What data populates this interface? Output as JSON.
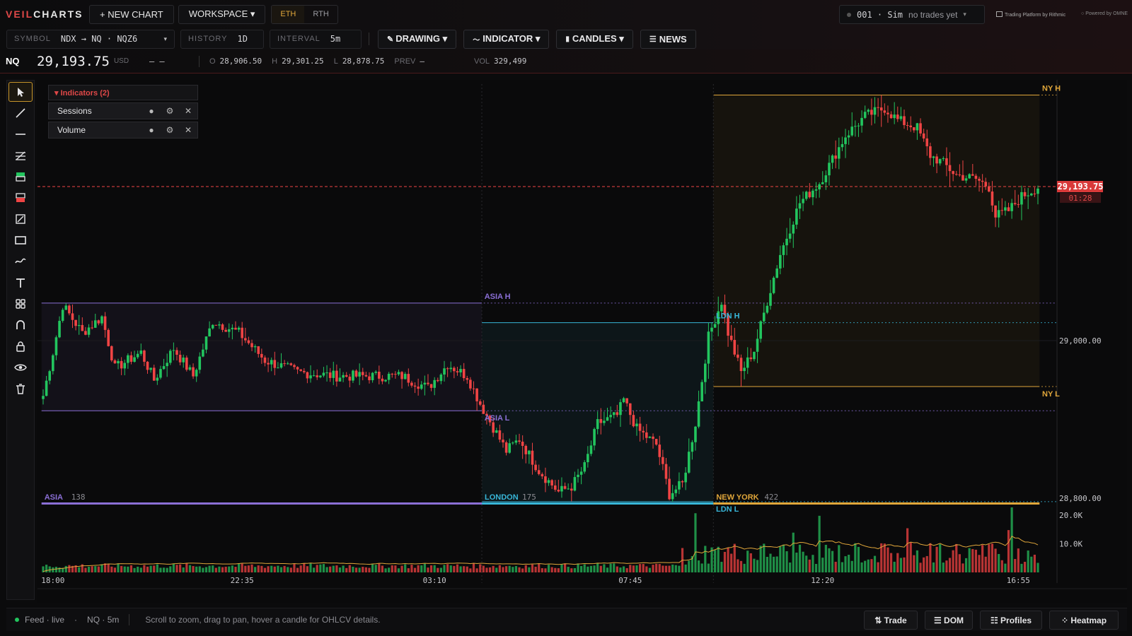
{
  "app": {
    "logo_a": "VEIL",
    "logo_b": "CHARTS"
  },
  "topbar": {
    "new_chart": "+ NEW CHART",
    "workspace": "WORKSPACE ▾",
    "seg_eth": "ETH",
    "seg_rth": "RTH",
    "account": "001 · Sim",
    "account_status": "no trades yet",
    "account_caret": "▾",
    "brand_1": "Trading Platform by Rithmic",
    "brand_2": "Powered by OMNE"
  },
  "toolbar2": {
    "symbol_label": "SYMBOL",
    "symbol_value": "NDX → NQ · NQZ6",
    "symbol_caret": "▾",
    "history_label": "HISTORY",
    "history_value": "1D",
    "interval_label": "INTERVAL",
    "interval_value": "5m",
    "drawing": "DRAWING ▾",
    "indicator": "INDICATOR ▾",
    "candles": "CANDLES ▾",
    "news": "NEWS"
  },
  "quote": {
    "symbol": "NQ",
    "price": "29,193.75",
    "currency": "USD",
    "change": "– –",
    "open_label": "O",
    "open": "28,906.50",
    "high_label": "H",
    "high": "29,301.25",
    "low_label": "L",
    "low": "28,878.75",
    "prev_label": "PREV",
    "prev": "–",
    "vol_label": "VOL",
    "vol": "329,499"
  },
  "indicators": {
    "header": "▾ Indicators (2)",
    "items": [
      {
        "name": "Sessions"
      },
      {
        "name": "Volume"
      }
    ]
  },
  "status": {
    "feed": "Feed · live",
    "sep": "·",
    "symbol_interval": "NQ · 5m",
    "hint": "Scroll to zoom, drag to pan, hover a candle for OHLCV details.",
    "btn_trade": "⇅ Trade",
    "btn_dom": "☰ DOM",
    "btn_profiles": "☷ Profiles",
    "btn_heatmap": "⁘ Heatmap"
  },
  "chart_data": {
    "type": "candlestick",
    "symbol": "NQ",
    "interval": "5m",
    "y_ticks": [
      "29,000.00",
      "28,800.00"
    ],
    "x_ticks": [
      "18:00",
      "22:35",
      "03:10",
      "07:45",
      "12:20",
      "16:55"
    ],
    "last_price": "29,193.75",
    "countdown": "01:28",
    "volume_ticks": [
      "20.0K",
      "10.0K"
    ],
    "colors": {
      "up": "#22c55e",
      "down": "#ef4444",
      "asia": "#8b6fd6",
      "london": "#38b6d8",
      "newyork": "#e0a63a"
    },
    "sessions": [
      {
        "name": "ASIA",
        "count": "138",
        "high_label": "ASIA H",
        "low_label": "ASIA L"
      },
      {
        "name": "LONDON",
        "count": "175",
        "high_label": "LDN H",
        "low_label": "LDN L"
      },
      {
        "name": "NEW YORK",
        "count": "422",
        "high_label": "NY H",
        "low_label": "NY L"
      }
    ],
    "path_keypoints": [
      [
        0,
        28930
      ],
      [
        3,
        28985
      ],
      [
        6,
        29045
      ],
      [
        12,
        29010
      ],
      [
        18,
        29030
      ],
      [
        22,
        28965
      ],
      [
        30,
        28985
      ],
      [
        34,
        28950
      ],
      [
        40,
        28990
      ],
      [
        46,
        28955
      ],
      [
        52,
        29025
      ],
      [
        60,
        29010
      ],
      [
        68,
        28975
      ],
      [
        78,
        28960
      ],
      [
        90,
        28955
      ],
      [
        100,
        28955
      ],
      [
        110,
        28955
      ],
      [
        118,
        28940
      ],
      [
        124,
        28970
      ],
      [
        130,
        28955
      ],
      [
        134,
        28920
      ],
      [
        138,
        28890
      ],
      [
        142,
        28860
      ],
      [
        146,
        28875
      ],
      [
        152,
        28835
      ],
      [
        158,
        28808
      ],
      [
        162,
        28815
      ],
      [
        166,
        28840
      ],
      [
        170,
        28895
      ],
      [
        176,
        28905
      ],
      [
        178,
        28925
      ],
      [
        182,
        28888
      ],
      [
        188,
        28868
      ],
      [
        190,
        28838
      ],
      [
        192,
        28805
      ],
      [
        196,
        28818
      ],
      [
        200,
        28895
      ],
      [
        204,
        29005
      ],
      [
        208,
        29050
      ],
      [
        210,
        29010
      ],
      [
        214,
        28960
      ],
      [
        218,
        28988
      ],
      [
        222,
        29050
      ],
      [
        226,
        29110
      ],
      [
        232,
        29175
      ],
      [
        238,
        29200
      ],
      [
        242,
        29230
      ],
      [
        246,
        29260
      ],
      [
        252,
        29285
      ],
      [
        258,
        29295
      ],
      [
        262,
        29280
      ],
      [
        268,
        29270
      ],
      [
        272,
        29235
      ],
      [
        276,
        29225
      ],
      [
        280,
        29210
      ],
      [
        286,
        29205
      ],
      [
        290,
        29195
      ],
      [
        292,
        29158
      ],
      [
        296,
        29165
      ],
      [
        300,
        29183
      ],
      [
        305,
        29195
      ]
    ]
  }
}
